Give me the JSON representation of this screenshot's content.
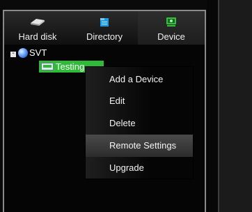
{
  "tabs": [
    {
      "label": "Hard disk",
      "icon": "hard-disk-icon"
    },
    {
      "label": "Directory",
      "icon": "directory-icon"
    },
    {
      "label": "Device",
      "icon": "device-icon",
      "active": true
    }
  ],
  "tree": {
    "root": {
      "label": "SVT",
      "icon": "globe-icon",
      "expander": "-"
    },
    "device": {
      "label": "Testing",
      "icon": "device-icon"
    }
  },
  "context_menu": {
    "items": [
      {
        "label": "Add a Device"
      },
      {
        "label": "Edit"
      },
      {
        "label": "Delete"
      },
      {
        "label": "Remote Settings",
        "highlighted": true
      },
      {
        "label": "Upgrade"
      }
    ]
  },
  "colors": {
    "selection": "#2fba38",
    "tab_icon": "#1e9be6",
    "device_tab_icon": "#32c23e"
  }
}
